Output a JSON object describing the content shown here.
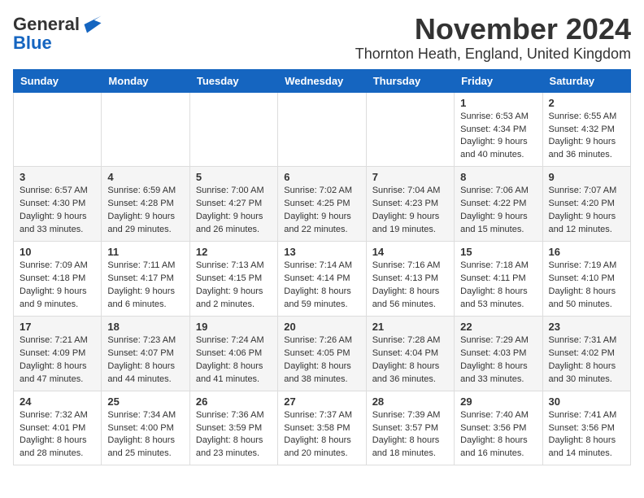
{
  "logo": {
    "general": "General",
    "blue": "Blue"
  },
  "title": "November 2024",
  "subtitle": "Thornton Heath, England, United Kingdom",
  "days_of_week": [
    "Sunday",
    "Monday",
    "Tuesday",
    "Wednesday",
    "Thursday",
    "Friday",
    "Saturday"
  ],
  "weeks": [
    [
      {
        "day": "",
        "info": ""
      },
      {
        "day": "",
        "info": ""
      },
      {
        "day": "",
        "info": ""
      },
      {
        "day": "",
        "info": ""
      },
      {
        "day": "",
        "info": ""
      },
      {
        "day": "1",
        "info": "Sunrise: 6:53 AM\nSunset: 4:34 PM\nDaylight: 9 hours and 40 minutes."
      },
      {
        "day": "2",
        "info": "Sunrise: 6:55 AM\nSunset: 4:32 PM\nDaylight: 9 hours and 36 minutes."
      }
    ],
    [
      {
        "day": "3",
        "info": "Sunrise: 6:57 AM\nSunset: 4:30 PM\nDaylight: 9 hours and 33 minutes."
      },
      {
        "day": "4",
        "info": "Sunrise: 6:59 AM\nSunset: 4:28 PM\nDaylight: 9 hours and 29 minutes."
      },
      {
        "day": "5",
        "info": "Sunrise: 7:00 AM\nSunset: 4:27 PM\nDaylight: 9 hours and 26 minutes."
      },
      {
        "day": "6",
        "info": "Sunrise: 7:02 AM\nSunset: 4:25 PM\nDaylight: 9 hours and 22 minutes."
      },
      {
        "day": "7",
        "info": "Sunrise: 7:04 AM\nSunset: 4:23 PM\nDaylight: 9 hours and 19 minutes."
      },
      {
        "day": "8",
        "info": "Sunrise: 7:06 AM\nSunset: 4:22 PM\nDaylight: 9 hours and 15 minutes."
      },
      {
        "day": "9",
        "info": "Sunrise: 7:07 AM\nSunset: 4:20 PM\nDaylight: 9 hours and 12 minutes."
      }
    ],
    [
      {
        "day": "10",
        "info": "Sunrise: 7:09 AM\nSunset: 4:18 PM\nDaylight: 9 hours and 9 minutes."
      },
      {
        "day": "11",
        "info": "Sunrise: 7:11 AM\nSunset: 4:17 PM\nDaylight: 9 hours and 6 minutes."
      },
      {
        "day": "12",
        "info": "Sunrise: 7:13 AM\nSunset: 4:15 PM\nDaylight: 9 hours and 2 minutes."
      },
      {
        "day": "13",
        "info": "Sunrise: 7:14 AM\nSunset: 4:14 PM\nDaylight: 8 hours and 59 minutes."
      },
      {
        "day": "14",
        "info": "Sunrise: 7:16 AM\nSunset: 4:13 PM\nDaylight: 8 hours and 56 minutes."
      },
      {
        "day": "15",
        "info": "Sunrise: 7:18 AM\nSunset: 4:11 PM\nDaylight: 8 hours and 53 minutes."
      },
      {
        "day": "16",
        "info": "Sunrise: 7:19 AM\nSunset: 4:10 PM\nDaylight: 8 hours and 50 minutes."
      }
    ],
    [
      {
        "day": "17",
        "info": "Sunrise: 7:21 AM\nSunset: 4:09 PM\nDaylight: 8 hours and 47 minutes."
      },
      {
        "day": "18",
        "info": "Sunrise: 7:23 AM\nSunset: 4:07 PM\nDaylight: 8 hours and 44 minutes."
      },
      {
        "day": "19",
        "info": "Sunrise: 7:24 AM\nSunset: 4:06 PM\nDaylight: 8 hours and 41 minutes."
      },
      {
        "day": "20",
        "info": "Sunrise: 7:26 AM\nSunset: 4:05 PM\nDaylight: 8 hours and 38 minutes."
      },
      {
        "day": "21",
        "info": "Sunrise: 7:28 AM\nSunset: 4:04 PM\nDaylight: 8 hours and 36 minutes."
      },
      {
        "day": "22",
        "info": "Sunrise: 7:29 AM\nSunset: 4:03 PM\nDaylight: 8 hours and 33 minutes."
      },
      {
        "day": "23",
        "info": "Sunrise: 7:31 AM\nSunset: 4:02 PM\nDaylight: 8 hours and 30 minutes."
      }
    ],
    [
      {
        "day": "24",
        "info": "Sunrise: 7:32 AM\nSunset: 4:01 PM\nDaylight: 8 hours and 28 minutes."
      },
      {
        "day": "25",
        "info": "Sunrise: 7:34 AM\nSunset: 4:00 PM\nDaylight: 8 hours and 25 minutes."
      },
      {
        "day": "26",
        "info": "Sunrise: 7:36 AM\nSunset: 3:59 PM\nDaylight: 8 hours and 23 minutes."
      },
      {
        "day": "27",
        "info": "Sunrise: 7:37 AM\nSunset: 3:58 PM\nDaylight: 8 hours and 20 minutes."
      },
      {
        "day": "28",
        "info": "Sunrise: 7:39 AM\nSunset: 3:57 PM\nDaylight: 8 hours and 18 minutes."
      },
      {
        "day": "29",
        "info": "Sunrise: 7:40 AM\nSunset: 3:56 PM\nDaylight: 8 hours and 16 minutes."
      },
      {
        "day": "30",
        "info": "Sunrise: 7:41 AM\nSunset: 3:56 PM\nDaylight: 8 hours and 14 minutes."
      }
    ]
  ]
}
